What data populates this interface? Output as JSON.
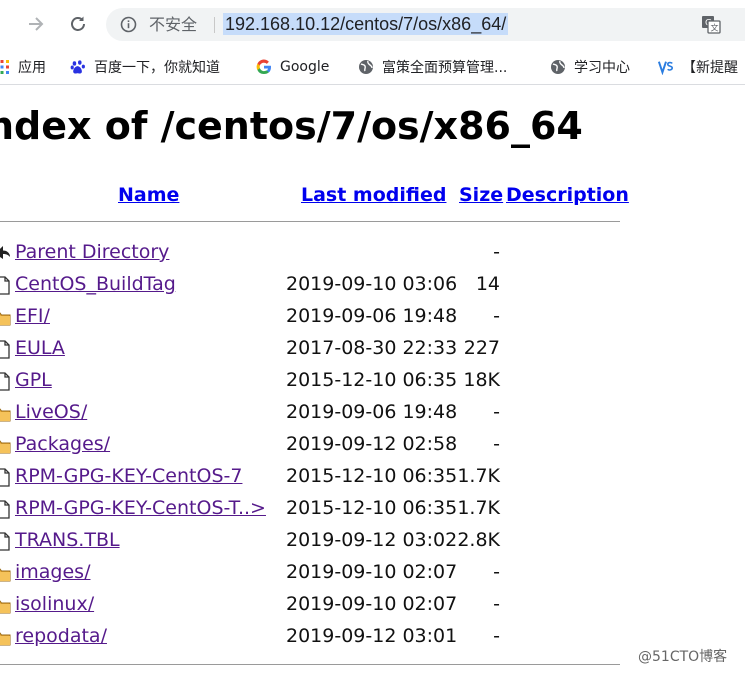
{
  "browser": {
    "security_label": "不安全",
    "url": "192.168.10.12/centos/7/os/x86_64/"
  },
  "bookmarks": [
    {
      "label": "应用",
      "icon": "apps-grid-icon"
    },
    {
      "label": "百度一下，你就知道",
      "icon": "baidu-paw-icon"
    },
    {
      "label": "Google",
      "icon": "google-g-icon"
    },
    {
      "label": "富策全面预算管理...",
      "icon": "globe-icon"
    },
    {
      "label": "学习中心",
      "icon": "globe-icon"
    },
    {
      "label": "【新提醒",
      "icon": "vs-logo-icon"
    }
  ],
  "page": {
    "title": "ndex of /centos/7/os/x86_64",
    "headers": {
      "name": "Name",
      "last_modified": "Last modified",
      "size": "Size",
      "description": "Description"
    },
    "rows": [
      {
        "name": "Parent Directory",
        "date": "",
        "size": "-",
        "icon": "back-arrow-icon"
      },
      {
        "name": "CentOS_BuildTag",
        "date": "2019-09-10 03:06",
        "size": "14",
        "icon": "file-icon"
      },
      {
        "name": "EFI/",
        "date": "2019-09-06 19:48",
        "size": "-",
        "icon": "folder-icon"
      },
      {
        "name": "EULA",
        "date": "2017-08-30 22:33",
        "size": "227",
        "icon": "file-icon"
      },
      {
        "name": "GPL",
        "date": "2015-12-10 06:35",
        "size": "18K",
        "icon": "file-icon"
      },
      {
        "name": "LiveOS/",
        "date": "2019-09-06 19:48",
        "size": "-",
        "icon": "folder-icon"
      },
      {
        "name": "Packages/",
        "date": "2019-09-12 02:58",
        "size": "-",
        "icon": "folder-icon"
      },
      {
        "name": "RPM-GPG-KEY-CentOS-7",
        "date": "2015-12-10 06:35",
        "size": "1.7K",
        "icon": "file-icon"
      },
      {
        "name": "RPM-GPG-KEY-CentOS-T..>",
        "date": "2015-12-10 06:35",
        "size": "1.7K",
        "icon": "file-icon"
      },
      {
        "name": "TRANS.TBL",
        "date": "2019-09-12 03:02",
        "size": "2.8K",
        "icon": "file-icon"
      },
      {
        "name": "images/",
        "date": "2019-09-10 02:07",
        "size": "-",
        "icon": "folder-icon"
      },
      {
        "name": "isolinux/",
        "date": "2019-09-10 02:07",
        "size": "-",
        "icon": "folder-icon"
      },
      {
        "name": "repodata/",
        "date": "2019-09-12 03:01",
        "size": "-",
        "icon": "folder-icon"
      }
    ]
  },
  "watermark": "@51CTO博客",
  "colors": {
    "link": "#0000ee",
    "visited_link": "#551a8b",
    "url_highlight": "#c6dcfa",
    "folder": "#e8a93a"
  }
}
